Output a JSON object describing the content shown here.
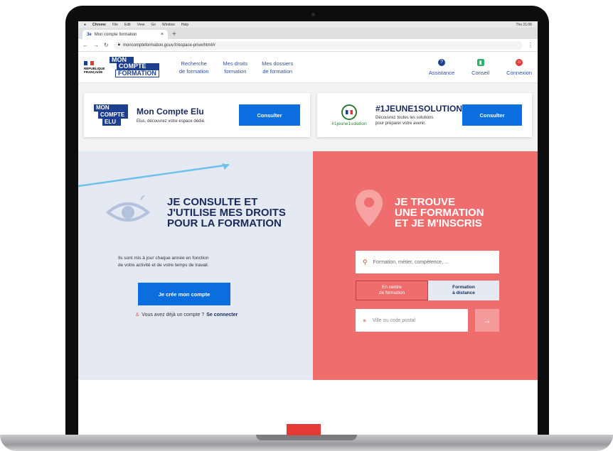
{
  "menubar": {
    "apple": "",
    "app": "Chrome",
    "items": [
      "File",
      "Edit",
      "View",
      "Go",
      "Window",
      "Help"
    ],
    "right": "Thu 21:06"
  },
  "browser": {
    "tab_title": "Mon compte formation",
    "close": "×",
    "new_tab": "+",
    "url": "moncompteformation.gouv.fr/espace-prive/html/#"
  },
  "header": {
    "gov": [
      "RÉPUBLIQUE",
      "FRANÇAISE"
    ],
    "logo": [
      "MON",
      "COMPTE",
      "FORMATION"
    ],
    "nav": [
      {
        "l1": "Recherche",
        "l2": "de formation"
      },
      {
        "l1": "Mes droits",
        "l2": "formation"
      },
      {
        "l1": "Mes dossiers",
        "l2": "de formation"
      }
    ],
    "actions": [
      {
        "label": "Assistance",
        "icon": "?",
        "color": "#1d3f8f"
      },
      {
        "label": "Conseil",
        "icon": "▮",
        "color": "#2fb36f"
      },
      {
        "label": "Connexion",
        "icon": "☺",
        "color": "#e53935"
      }
    ]
  },
  "promo": {
    "elu": {
      "logo": [
        "MON",
        "COMPTE",
        "ELU"
      ],
      "title": "Mon Compte Elu",
      "sub": "Elus, découvrez votre espace dédié.",
      "button": "Consulter"
    },
    "jeune": {
      "badge": "#1jeune1solution",
      "title": "#1JEUNE1SOLUTION",
      "sub1": "Découvrez toutes les solutions",
      "sub2": "pour préparer votre avenir.",
      "button": "Consulter"
    }
  },
  "hero_left": {
    "title": [
      "JE CONSULTE ET",
      "J'UTILISE MES DROITS",
      "POUR LA FORMATION"
    ],
    "desc1": "Ils sont mis à jour chaque année en fonction",
    "desc2": "de votre activité et de votre temps de travail.",
    "button": "Je crée mon compte",
    "login_text": "Vous avez déjà un compte ?",
    "login_link": "Se connecter"
  },
  "hero_right": {
    "title": [
      "JE TROUVE",
      "UNE FORMATION",
      "ET JE M'INSCRIS"
    ],
    "search_placeholder": "Formation, métier, compétence, ...",
    "seg_on": [
      "En centre",
      "de formation"
    ],
    "seg_off": [
      "Formation",
      "à distance"
    ],
    "city_placeholder": "Ville ou code postal",
    "arrow": "→"
  }
}
